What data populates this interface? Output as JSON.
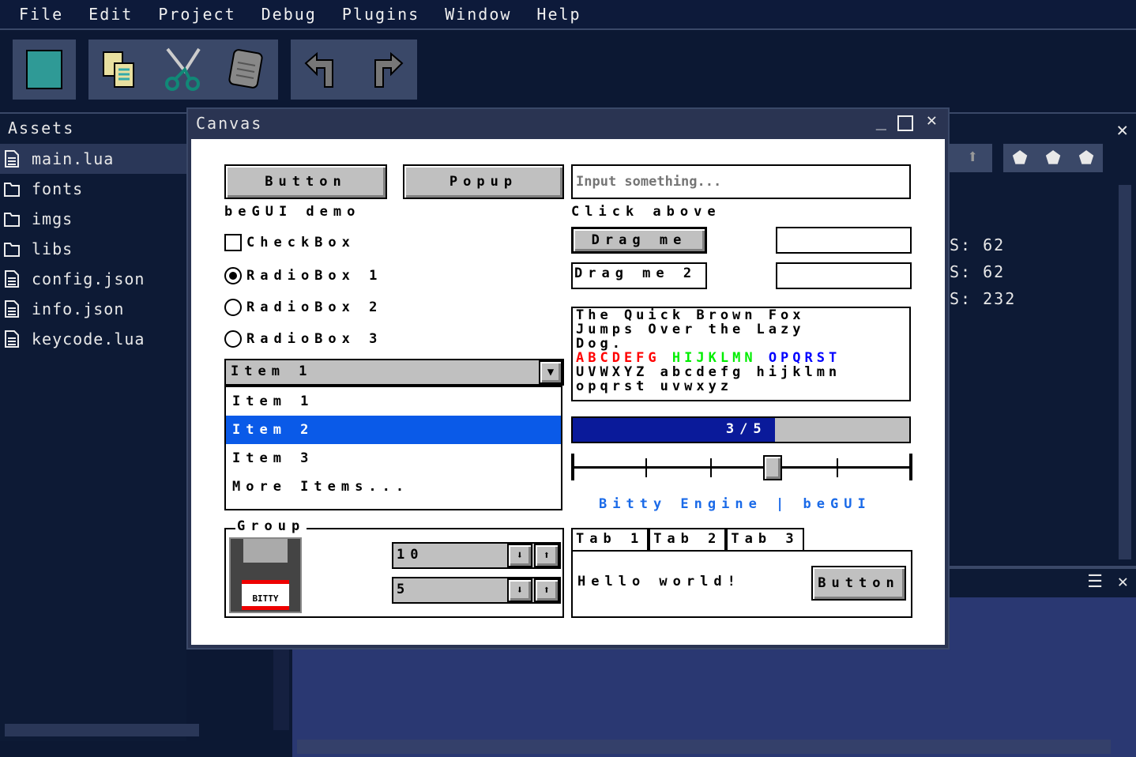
{
  "menu": [
    "File",
    "Edit",
    "Project",
    "Debug",
    "Plugins",
    "Window",
    "Help"
  ],
  "toolbar": {
    "icons": [
      "new-icon",
      "copy-icon",
      "cut-icon",
      "paste-icon",
      "undo-icon",
      "redo-icon"
    ]
  },
  "assets": {
    "title": "Assets",
    "items": [
      {
        "label": "main.lua",
        "type": "file",
        "selected": true
      },
      {
        "label": "fonts",
        "type": "folder"
      },
      {
        "label": "imgs",
        "type": "folder"
      },
      {
        "label": "libs",
        "type": "folder"
      },
      {
        "label": "config.json",
        "type": "file"
      },
      {
        "label": "info.json",
        "type": "file"
      },
      {
        "label": "keycode.lua",
        "type": "file"
      }
    ]
  },
  "canvas": {
    "title": "Canvas",
    "button_label": "Button",
    "popup_label": "Popup",
    "input_placeholder": "Input something...",
    "demo_label": "beGUI demo",
    "click_label": "Click above",
    "checkbox_label": "CheckBox",
    "checkbox_checked": false,
    "radios": [
      "RadioBox 1",
      "RadioBox 2",
      "RadioBox 3"
    ],
    "radio_selected": 0,
    "combo_value": "Item 1",
    "list_items": [
      "Item 1",
      "Item 2",
      "Item 3",
      "More Items..."
    ],
    "list_selected": 1,
    "drag1": "Drag me",
    "drag2": "Drag me 2",
    "text_lines": [
      "The Quick Brown Fox",
      "Jumps Over the Lazy",
      "Dog."
    ],
    "color_red": "ABCDEFG",
    "color_green": "HIJKLMN",
    "color_blue": "OPQRST",
    "text_lines2": [
      "UVWXYZ abcdefg hijklmn",
      "opqrst uvwxyz"
    ],
    "progress_label": "3/5",
    "progress": 0.6,
    "slider_value": 0.6,
    "link_label": "Bitty Engine | beGUI",
    "group_label": "Group",
    "floppy_label": "BITTY",
    "num1": "10",
    "num2": "5",
    "tabs": [
      "Tab 1",
      "Tab 2",
      "Tab 3"
    ],
    "tab_selected": 0,
    "tab_content": "Hello world!",
    "tab_button": "Button"
  },
  "stats": [
    "S: 62",
    "S: 62",
    "S: 232"
  ],
  "colors": {
    "bg": "#0c1833",
    "panel": "#3a4868",
    "select": "#0a5ae8",
    "progress": "#0a1a9a",
    "link": "#1a6ae8"
  }
}
